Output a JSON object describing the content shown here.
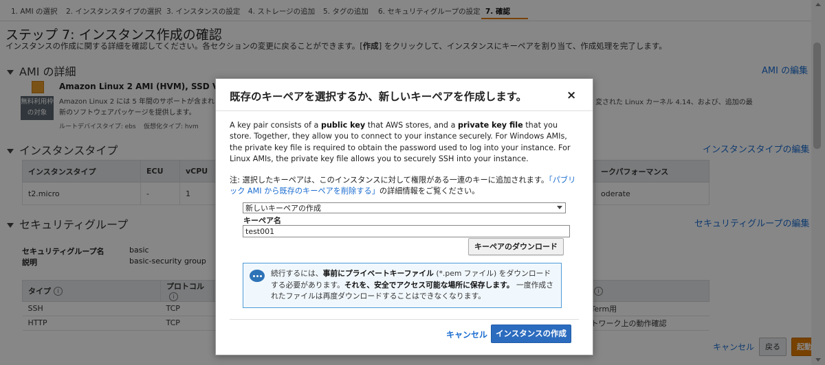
{
  "steps": [
    "1. AMI の選択",
    "2. インスタンスタイプの選択",
    "3. インスタンスの設定",
    "4. ストレージの追加",
    "5. タグの追加",
    "6. セキュリティグループの設定",
    "7. 確認"
  ],
  "page": {
    "title": "ステップ 7: インスタンス作成の確認",
    "subtitle_pre": "インスタンスの作成に関する詳細を確認してください。各セクションの変更に戻ることができます。[",
    "subtitle_bold": "作成",
    "subtitle_post": "] をクリックして、インスタンスにキーペアを割り当て、作成処理を完了します。"
  },
  "ami": {
    "section_title": "AMI の詳細",
    "edit_link": "AMI の編集",
    "name": "Amazon Linux 2 AMI (HVM), SSD Volume",
    "desc_line1": "Amazon Linux 2 には 5 年間のサポートが含まれま",
    "desc_line2": "新のソフトウェアパッケージを提供します。",
    "desc_right": "変された Linux カーネル 4.14、および、追加の最",
    "badge_line1": "無料利用枠",
    "badge_line2": "の対象",
    "root_device": "ルートデバイスタイプ: ebs",
    "virt_type": "仮想化タイプ: hvm"
  },
  "instance_type": {
    "section_title": "インスタンスタイプ",
    "edit_link": "インスタンスタイプの編集",
    "headers": [
      "インスタンスタイプ",
      "ECU",
      "vCPU",
      "",
      "ークパフォーマンス"
    ],
    "row": [
      "t2.micro",
      "-",
      "1",
      "",
      "oderate"
    ]
  },
  "security": {
    "section_title": "セキュリティグループ",
    "edit_link": "セキュリティグループの編集",
    "group_name_label": "セキュリティグループ名",
    "group_name_value": "basic",
    "desc_label": "説明",
    "desc_value": "basic-security group",
    "rule_headers": [
      "タイプ",
      "プロトコル",
      "",
      ""
    ],
    "rules": [
      [
        "SSH",
        "TCP",
        "",
        "Term用"
      ],
      [
        "HTTP",
        "TCP",
        "",
        "トワーク上の動作確認"
      ]
    ]
  },
  "footer": {
    "cancel": "キャンセル",
    "back": "戻る",
    "launch": "起動"
  },
  "modal": {
    "title": "既存のキーペアを選択するか、新しいキーペアを作成します。",
    "close": "×",
    "intro_1": "A key pair consists of a ",
    "intro_b1": "public key",
    "intro_2": " that AWS stores, and a ",
    "intro_b2": "private key file",
    "intro_3": " that you store. Together, they allow you to connect to your instance securely. For Windows AMIs, the private key file is required to obtain the password used to log into your instance. For Linux AMIs, the private key file allows you to securely SSH into your instance.",
    "note_1": "注: 選択したキーペアは、このインスタンスに対して権限がある一連のキーに追加されます。",
    "note_link": "「パブリック AMI から既存のキーペアを削除する」",
    "note_2": "の詳細情報をご覧ください。",
    "select_value": "新しいキーペアの作成",
    "keypair_label": "キーペア名",
    "keypair_value": "test001",
    "download_button": "キーペアのダウンロード",
    "info_1": "続行するには、",
    "info_b1": "事前にプライベートキーファイル",
    "info_2": " (*.pem ファイル) をダウンロードする必要があります。",
    "info_b2": "それを、安全でアクセス可能な場所に保存します。",
    "info_3": " 一度作成されたファイルは再度ダウンロードすることはできなくなります。",
    "cancel_button": "キャンセル",
    "create_button": "インスタンスの作成"
  },
  "colors": {
    "link": "#1a6cd0",
    "primary_button": "#2b6cbf",
    "launch_button": "#e07b00",
    "info_border": "#4d9ad6"
  }
}
